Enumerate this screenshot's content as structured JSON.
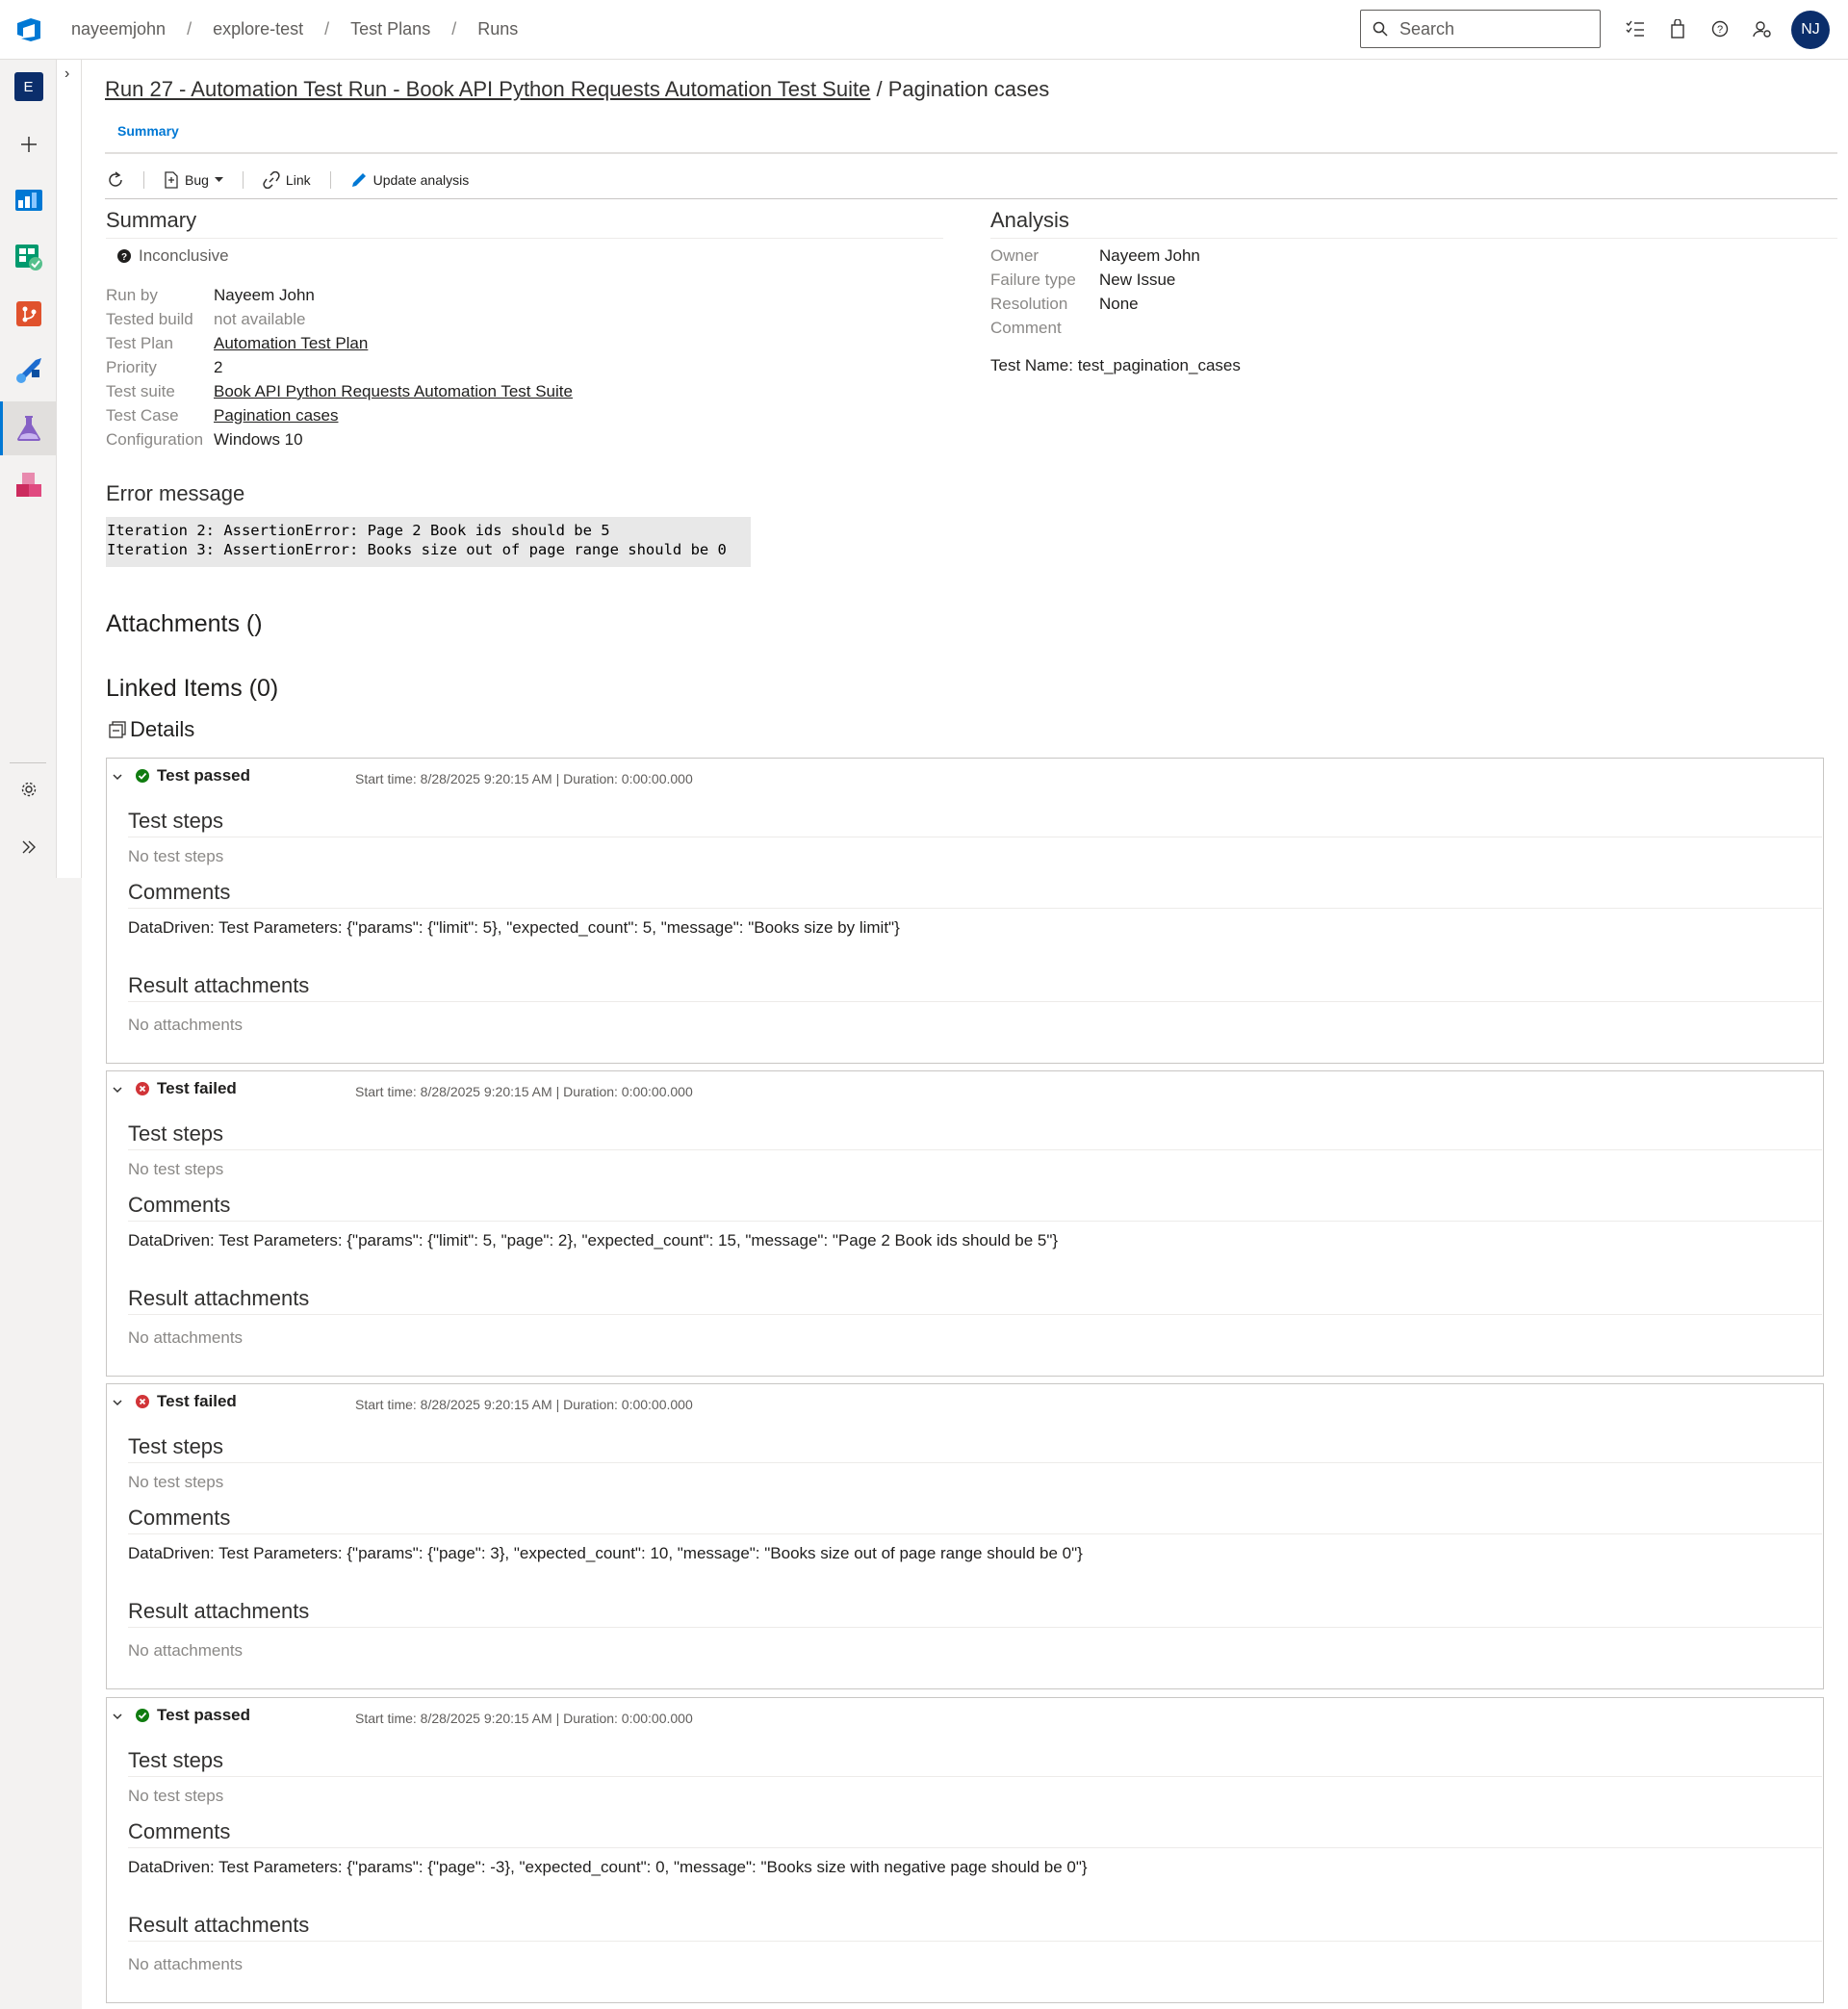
{
  "breadcrumbs": [
    "nayeemjohn",
    "explore-test",
    "Test Plans",
    "Runs"
  ],
  "search": {
    "placeholder": "Search"
  },
  "user": {
    "initials": "NJ"
  },
  "project": {
    "initial": "E"
  },
  "page": {
    "title_link": "Run 27 - Automation Test Run - Book API Python Requests Automation Test Suite",
    "title_separator": "/",
    "title_rest": "Pagination cases",
    "tab": "Summary"
  },
  "toolbar": {
    "bug": "Bug",
    "link": "Link",
    "update": "Update analysis"
  },
  "summary": {
    "heading": "Summary",
    "status": "Inconclusive",
    "fields": [
      {
        "key": "Run by",
        "value": "Nayeem John",
        "link": false
      },
      {
        "key": "Tested build",
        "value": "not available",
        "link": false,
        "muted": true
      },
      {
        "key": "Test Plan",
        "value": "Automation Test Plan",
        "link": true
      },
      {
        "key": "Priority",
        "value": "2",
        "link": false
      },
      {
        "key": "Test suite",
        "value": "Book API Python Requests Automation Test Suite",
        "link": true
      },
      {
        "key": "Test Case",
        "value": "Pagination cases",
        "link": true
      },
      {
        "key": "Configuration",
        "value": "Windows 10",
        "link": false
      }
    ]
  },
  "analysis": {
    "heading": "Analysis",
    "fields": [
      {
        "key": "Owner",
        "value": "Nayeem John"
      },
      {
        "key": "Failure type",
        "value": "New Issue"
      },
      {
        "key": "Resolution",
        "value": "None"
      },
      {
        "key": "Comment",
        "value": ""
      }
    ],
    "test_name": "Test Name: test_pagination_cases"
  },
  "error": {
    "heading": "Error message",
    "lines": [
      "Iteration 2: AssertionError: Page 2 Book ids should be 5",
      "Iteration 3: AssertionError: Books size out of page range should be 0"
    ]
  },
  "attachments_heading": "Attachments ()",
  "linked_heading": "Linked Items (0)",
  "details_heading": "Details",
  "iterations": [
    {
      "status": "Test passed",
      "outcome": "passed",
      "time": "Start time: 8/28/2025 9:20:15 AM | Duration: 0:00:00.000",
      "steps_heading": "Test steps",
      "steps": "No test steps",
      "comments_heading": "Comments",
      "comment": "DataDriven: Test Parameters: {\"params\": {\"limit\": 5}, \"expected_count\": 5, \"message\": \"Books size by limit\"}",
      "attachments_heading": "Result attachments",
      "attachments": "No attachments"
    },
    {
      "status": "Test failed",
      "outcome": "failed",
      "time": "Start time: 8/28/2025 9:20:15 AM | Duration: 0:00:00.000",
      "steps_heading": "Test steps",
      "steps": "No test steps",
      "comments_heading": "Comments",
      "comment": "DataDriven: Test Parameters: {\"params\": {\"limit\": 5, \"page\": 2}, \"expected_count\": 15, \"message\": \"Page 2 Book ids should be 5\"}",
      "attachments_heading": "Result attachments",
      "attachments": "No attachments"
    },
    {
      "status": "Test failed",
      "outcome": "failed",
      "time": "Start time: 8/28/2025 9:20:15 AM | Duration: 0:00:00.000",
      "steps_heading": "Test steps",
      "steps": "No test steps",
      "comments_heading": "Comments",
      "comment": "DataDriven: Test Parameters: {\"params\": {\"page\": 3}, \"expected_count\": 10, \"message\": \"Books size out of page range should be 0\"}",
      "attachments_heading": "Result attachments",
      "attachments": "No attachments"
    },
    {
      "status": "Test passed",
      "outcome": "passed",
      "time": "Start time: 8/28/2025 9:20:15 AM | Duration: 0:00:00.000",
      "steps_heading": "Test steps",
      "steps": "No test steps",
      "comments_heading": "Comments",
      "comment": "DataDriven: Test Parameters: {\"params\": {\"page\": -3}, \"expected_count\": 0, \"message\": \"Books size with negative page should be 0\"}",
      "attachments_heading": "Result attachments",
      "attachments": "No attachments"
    }
  ],
  "colors": {
    "accent": "#0078d4",
    "passed": "#107c10",
    "failed": "#d13438",
    "avatar": "#0b2e6b"
  }
}
